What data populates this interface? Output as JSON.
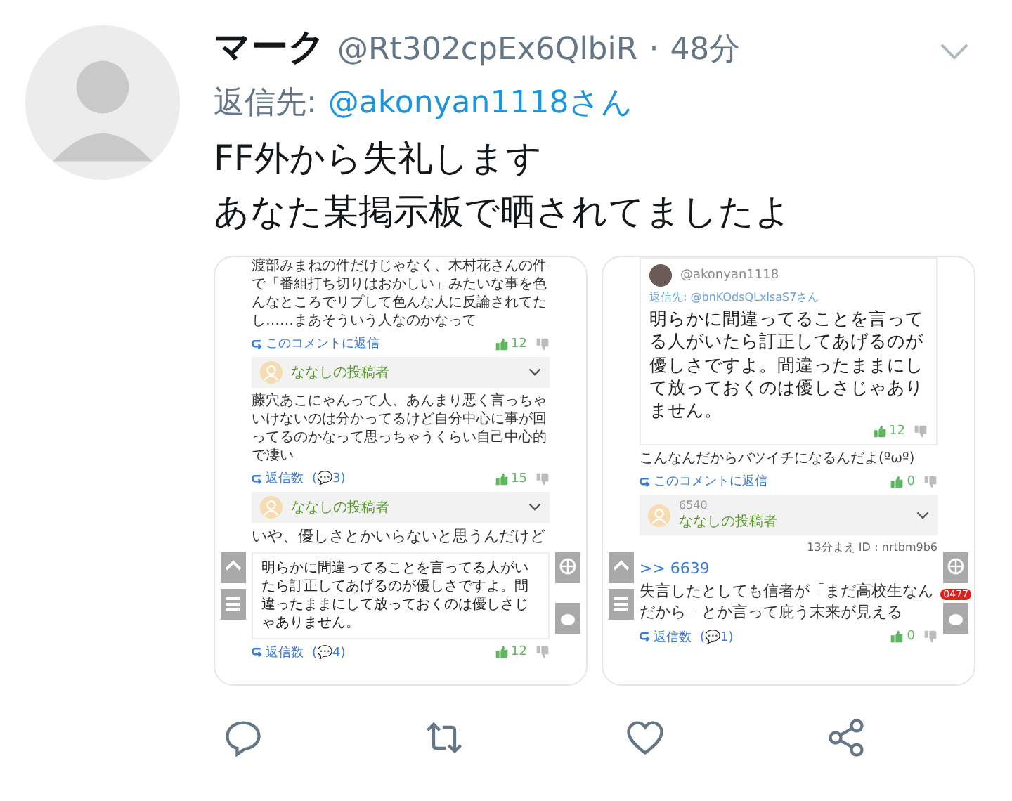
{
  "tweet": {
    "name": "マーク",
    "handle": "@Rt302cpEx6QlbiR",
    "separator": "·",
    "time": "48分",
    "reply_label": "返信先:",
    "reply_to": "@akonyan1118さん",
    "text_lines": [
      "FF外から失礼します",
      "あなた某掲示板で晒されてましたよ"
    ]
  },
  "attachments": [
    {
      "items": [
        {
          "kind": "comment",
          "text": "渡部みまねの件だけじゃなく、木村花さんの件で「番組打ち切りはおかしい」みたいな事を色んなところでリプして色んな人に反論されてたし……まあそういう人なのかなって"
        },
        {
          "kind": "actions",
          "reply": "このコメントに返信",
          "likes": "12"
        },
        {
          "kind": "poster",
          "name": "ななしの投稿者"
        },
        {
          "kind": "comment",
          "text": "藤穴あこにゃんって人、あんまり悪く言っちゃいけないのは分かってるけど自分中心に事が回ってるのかなって思っちゃうくらい自己中心的で凄い"
        },
        {
          "kind": "actions",
          "reply": "返信数",
          "replies": "(💬3)",
          "likes": "15"
        },
        {
          "kind": "poster",
          "name": "ななしの投稿者"
        },
        {
          "kind": "lead",
          "text": "いや、優しさとかいらないと思うんだけど"
        },
        {
          "kind": "quote",
          "text": "明らかに間違ってることを言ってる人がいたら訂正してあげるのが優しさですよ。間違ったままにして放っておくのは優しさじゃありません。"
        },
        {
          "kind": "actions",
          "reply": "返信数",
          "replies": "(💬4)",
          "likes": "12"
        }
      ]
    },
    {
      "items": [
        {
          "kind": "quote",
          "handle": "@akonyan1118",
          "reply_to": "返信先: @bnKOdsQLxlsaS7さん",
          "text": "明らかに間違ってることを言ってる人がいたら訂正してあげるのが優しさですよ。間違ったままにして放っておくのは優しさじゃありません。",
          "likes": "12"
        },
        {
          "kind": "comment",
          "text": "こんなんだからバツイチになるんだよ(ºωº)"
        },
        {
          "kind": "actions",
          "reply": "このコメントに返信",
          "likes": "0"
        },
        {
          "kind": "poster",
          "number": "6540",
          "name": "ななしの投稿者"
        },
        {
          "kind": "meta",
          "text": "13分まえ ID：nrtbm9b6"
        },
        {
          "kind": "anchor",
          "text": ">> 6639"
        },
        {
          "kind": "lead",
          "text": "失言したとしても信者が「まだ高校生なんだから」とか言って庇う末来が見える"
        },
        {
          "kind": "actions",
          "reply": "返信数",
          "replies": "(💬1)",
          "likes": "0"
        }
      ],
      "badge": "0477"
    }
  ]
}
